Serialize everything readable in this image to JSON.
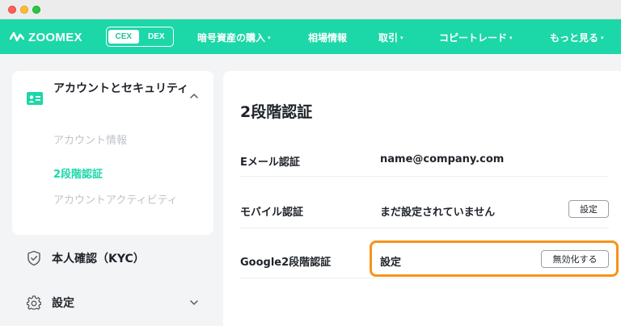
{
  "brand": {
    "name": "ZOOMEX"
  },
  "switch": {
    "cex": "CEX",
    "dex": "DEX"
  },
  "nav": {
    "items": [
      {
        "label": "暗号資産の購入",
        "caret": "▾"
      },
      {
        "label": "相場情報",
        "caret": ""
      },
      {
        "label": "取引",
        "caret": "▾"
      },
      {
        "label": "コピートレード",
        "caret": "▾"
      },
      {
        "label": "もっと見る",
        "caret": "▾"
      }
    ]
  },
  "sidebar": {
    "section_title": "アカウントとセキュリティ",
    "sub_items": [
      "アカウント情報",
      "2段階認証",
      "アカウントアクティビティ"
    ],
    "kyc_label": "本人確認（KYC）",
    "settings_label": "設定"
  },
  "main": {
    "title": "2段階認証",
    "rows": [
      {
        "label": "Eメール認証",
        "value": "name@company.com",
        "button": ""
      },
      {
        "label": "モバイル認証",
        "value": "まだ設定されていません",
        "button": "設定"
      },
      {
        "label": "Google2段階認証",
        "value": "設定",
        "button": "無効化する"
      }
    ]
  },
  "colors": {
    "accent": "#1cd7a8",
    "highlight": "#f7931a"
  },
  "icons": [
    "logo-mark-icon",
    "id-card-icon",
    "chevron-up-icon",
    "shield-check-icon",
    "gear-icon",
    "chevron-down-icon"
  ]
}
